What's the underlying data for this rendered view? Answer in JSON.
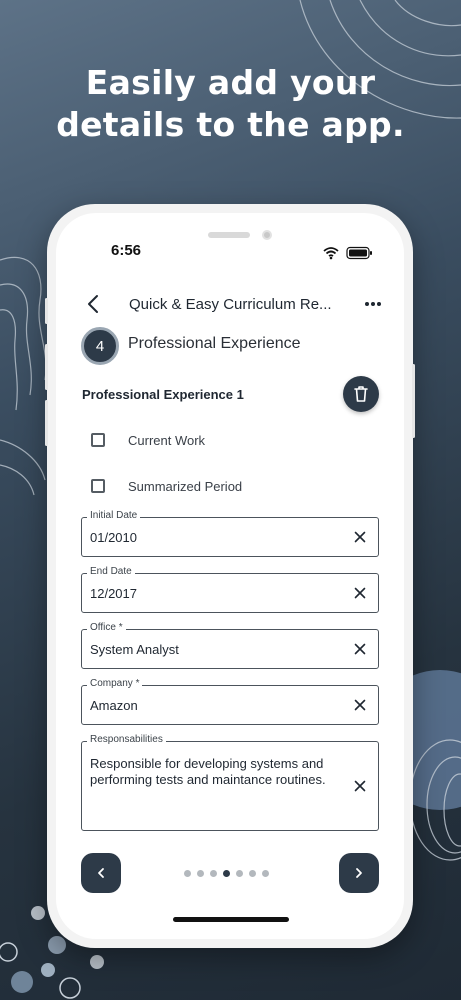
{
  "headline": {
    "line1": "Easily add your",
    "line2": "details to the app."
  },
  "status_bar": {
    "time": "6:56"
  },
  "nav": {
    "title": "Quick & Easy Curriculum Re...",
    "back_icon": "chevron-left-icon",
    "menu_icon": "more-horizontal-icon"
  },
  "step": {
    "number": "4",
    "title": "Professional Experience"
  },
  "section": {
    "title": "Professional Experience 1",
    "delete_icon": "trash-icon"
  },
  "checkboxes": [
    {
      "label": "Current Work",
      "checked": false
    },
    {
      "label": "Summarized Period",
      "checked": false
    }
  ],
  "fields": {
    "initial_date": {
      "label": "Initial Date",
      "value": "01/2010"
    },
    "end_date": {
      "label": "End Date",
      "value": "12/2017"
    },
    "office": {
      "label": "Office *",
      "value": "System Analyst"
    },
    "company": {
      "label": "Company *",
      "value": "Amazon"
    },
    "responsibilities": {
      "label": "Responsabilities",
      "value": "Responsible for developing systems and performing tests and maintance routines."
    }
  },
  "pagination": {
    "total": 7,
    "active_index": 3
  },
  "colors": {
    "primary_dark": "#2d3a48",
    "background": "#2b3947",
    "dot_inactive": "#b3b8bd"
  }
}
